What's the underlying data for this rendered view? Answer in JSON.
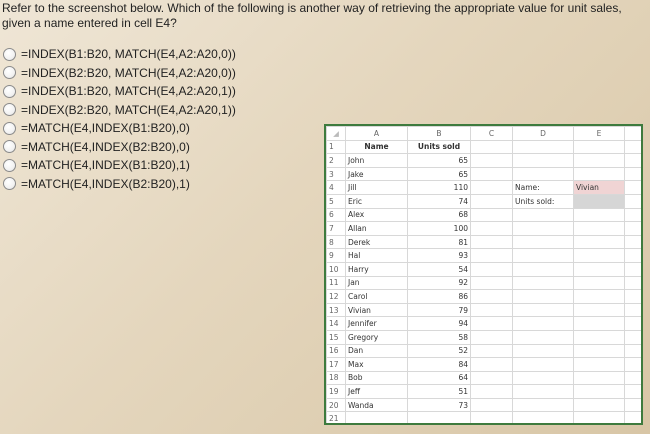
{
  "question": "Refer to the screenshot below. Which of the following is another way of retrieving the appropriate value for unit sales, given a name entered in cell E4?",
  "options": [
    "=INDEX(B1:B20, MATCH(E4,A2:A20,0))",
    "=INDEX(B2:B20, MATCH(E4,A2:A20,0))",
    "=INDEX(B1:B20, MATCH(E4,A2:A20,1))",
    "=INDEX(B2:B20, MATCH(E4,A2:A20,1))",
    "=MATCH(E4,INDEX(B1:B20),0)",
    "=MATCH(E4,INDEX(B2:B20),0)",
    "=MATCH(E4,INDEX(B1:B20),1)",
    "=MATCH(E4,INDEX(B2:B20),1)"
  ],
  "spreadsheet": {
    "columns": [
      "A",
      "B",
      "C",
      "D",
      "E"
    ],
    "headers": {
      "name": "Name",
      "units": "Units sold"
    },
    "rows": [
      [
        "John",
        65
      ],
      [
        "Jake",
        65
      ],
      [
        "Jill",
        110
      ],
      [
        "Eric",
        74
      ],
      [
        "Alex",
        68
      ],
      [
        "Allan",
        100
      ],
      [
        "Derek",
        81
      ],
      [
        "Hal",
        93
      ],
      [
        "Harry",
        54
      ],
      [
        "Jan",
        92
      ],
      [
        "Carol",
        86
      ],
      [
        "Vivian",
        79
      ],
      [
        "Jennifer",
        94
      ],
      [
        "Gregory",
        58
      ],
      [
        "Dan",
        52
      ],
      [
        "Max",
        84
      ],
      [
        "Bob",
        64
      ],
      [
        "Jeff",
        51
      ],
      [
        "Wanda",
        73
      ]
    ],
    "lookup": {
      "name_label": "Name:",
      "name_value": "Vivian",
      "units_label": "Units sold:",
      "units_value": ""
    },
    "colors": {
      "border": "#3e7b3e",
      "name_cell": "#f0d4d4",
      "units_cell": "#d6d6d6"
    }
  }
}
